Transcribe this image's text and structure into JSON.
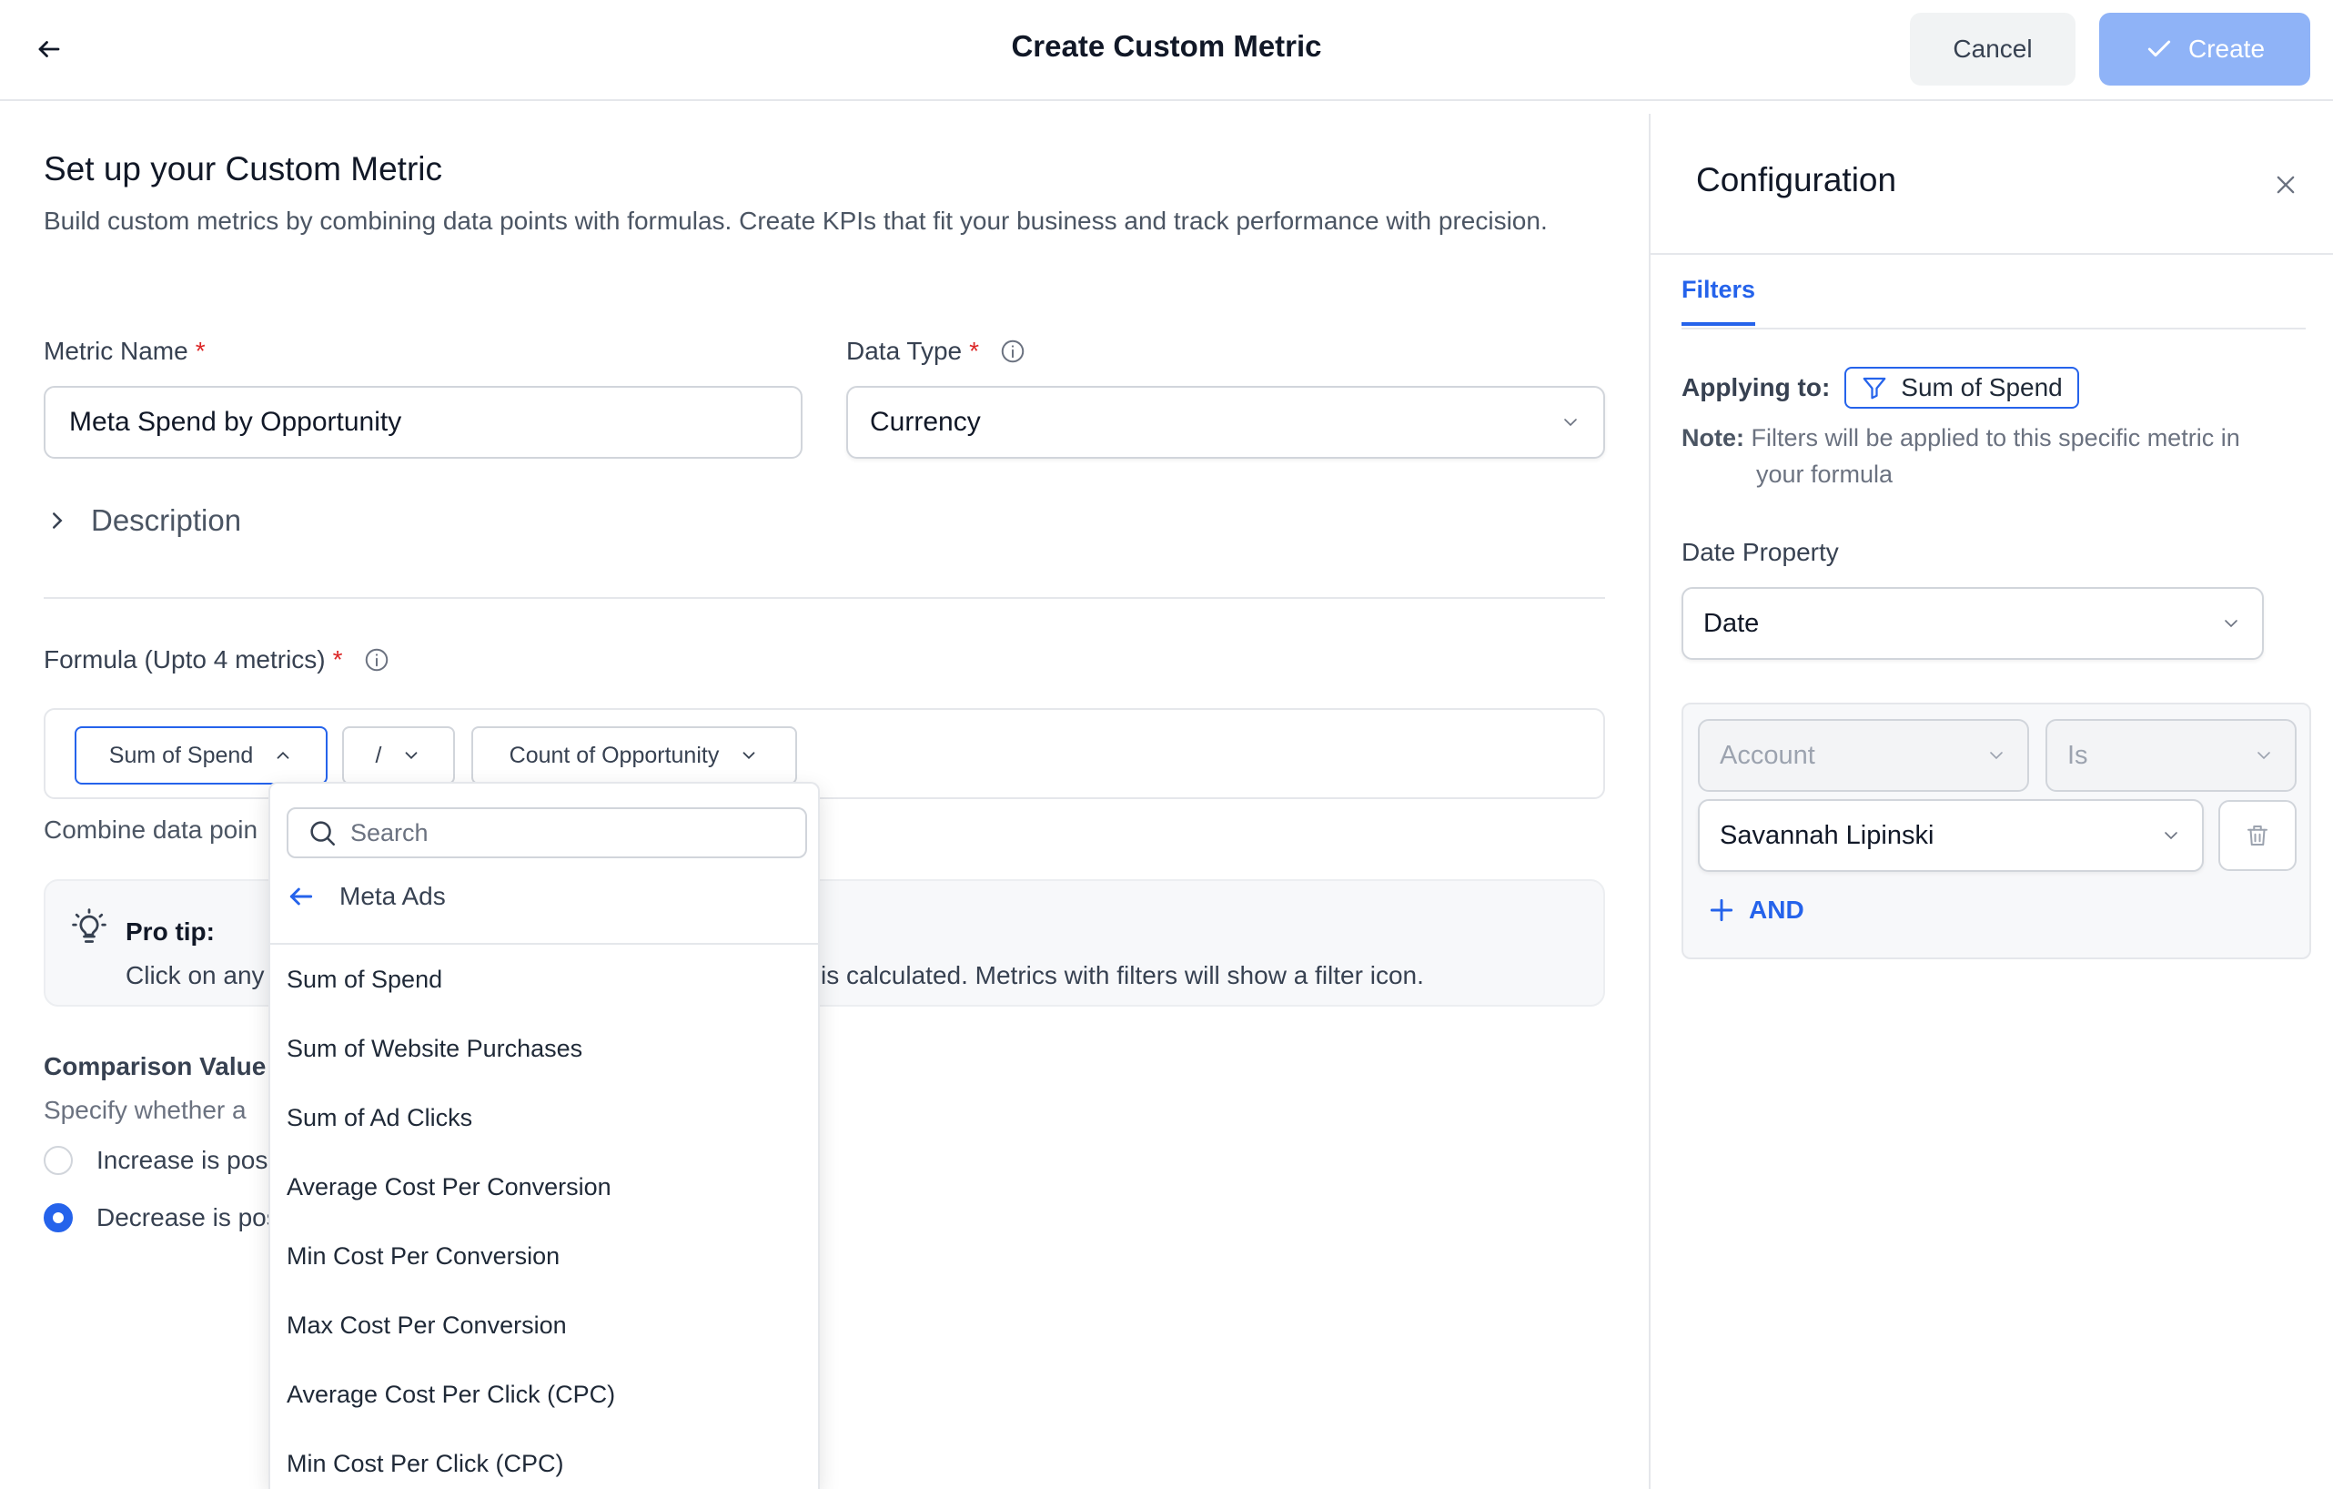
{
  "header": {
    "title": "Create Custom Metric",
    "cancel_label": "Cancel",
    "create_label": "Create"
  },
  "setup": {
    "title": "Set up your Custom Metric",
    "description": "Build custom metrics by combining data points with formulas. Create KPIs that fit your business and track performance with precision."
  },
  "metric_name": {
    "label": "Metric Name",
    "required_mark": "*",
    "value": "Meta Spend by Opportunity"
  },
  "data_type": {
    "label": "Data Type",
    "required_mark": "*",
    "value": "Currency"
  },
  "description_toggle": {
    "label": "Description"
  },
  "formula": {
    "label": "Formula (Upto 4 metrics)",
    "required_mark": "*",
    "chips": [
      "Sum of Spend",
      "/",
      "Count of Opportunity"
    ],
    "combine_text": "Combine data poin"
  },
  "pro_tip": {
    "title": "Pro tip:",
    "text_before": "Click on any",
    "text_after": "is calculated. Metrics with filters will show a filter icon."
  },
  "comparison": {
    "title": "Comparison Value",
    "description": "Specify whether a",
    "options": [
      {
        "label": "Increase is pos",
        "checked": false
      },
      {
        "label": "Decrease is pos",
        "checked": true
      }
    ]
  },
  "dropdown": {
    "search_placeholder": "Search",
    "back_label": "Meta Ads",
    "items": [
      "Sum of Spend",
      "Sum of Website Purchases",
      "Sum of Ad Clicks",
      "Average Cost Per Conversion",
      "Min Cost Per Conversion",
      "Max Cost Per Conversion",
      "Average Cost Per Click (CPC)",
      "Min Cost Per Click (CPC)"
    ]
  },
  "config": {
    "title": "Configuration",
    "tab": "Filters",
    "applying_label": "Applying to:",
    "applying_metric": "Sum of Spend",
    "note_label": "Note:",
    "note_line1": "Filters will be applied to this specific metric in",
    "note_line2": "your formula",
    "date_property_label": "Date Property",
    "date_property_value": "Date",
    "filter": {
      "field_placeholder": "Account",
      "operator_placeholder": "Is",
      "value": "Savannah Lipinski",
      "and_label": "AND"
    }
  },
  "colors": {
    "accent": "#2563eb",
    "create_button": "#8fb3f7",
    "required": "#dc2626"
  },
  "icons": [
    "arrow-left-icon",
    "check-icon",
    "info-icon",
    "chevron-right-icon",
    "chevron-down-icon",
    "chevron-up-icon",
    "search-icon",
    "lightbulb-icon",
    "close-icon",
    "filter-icon",
    "trash-icon",
    "plus-icon"
  ]
}
